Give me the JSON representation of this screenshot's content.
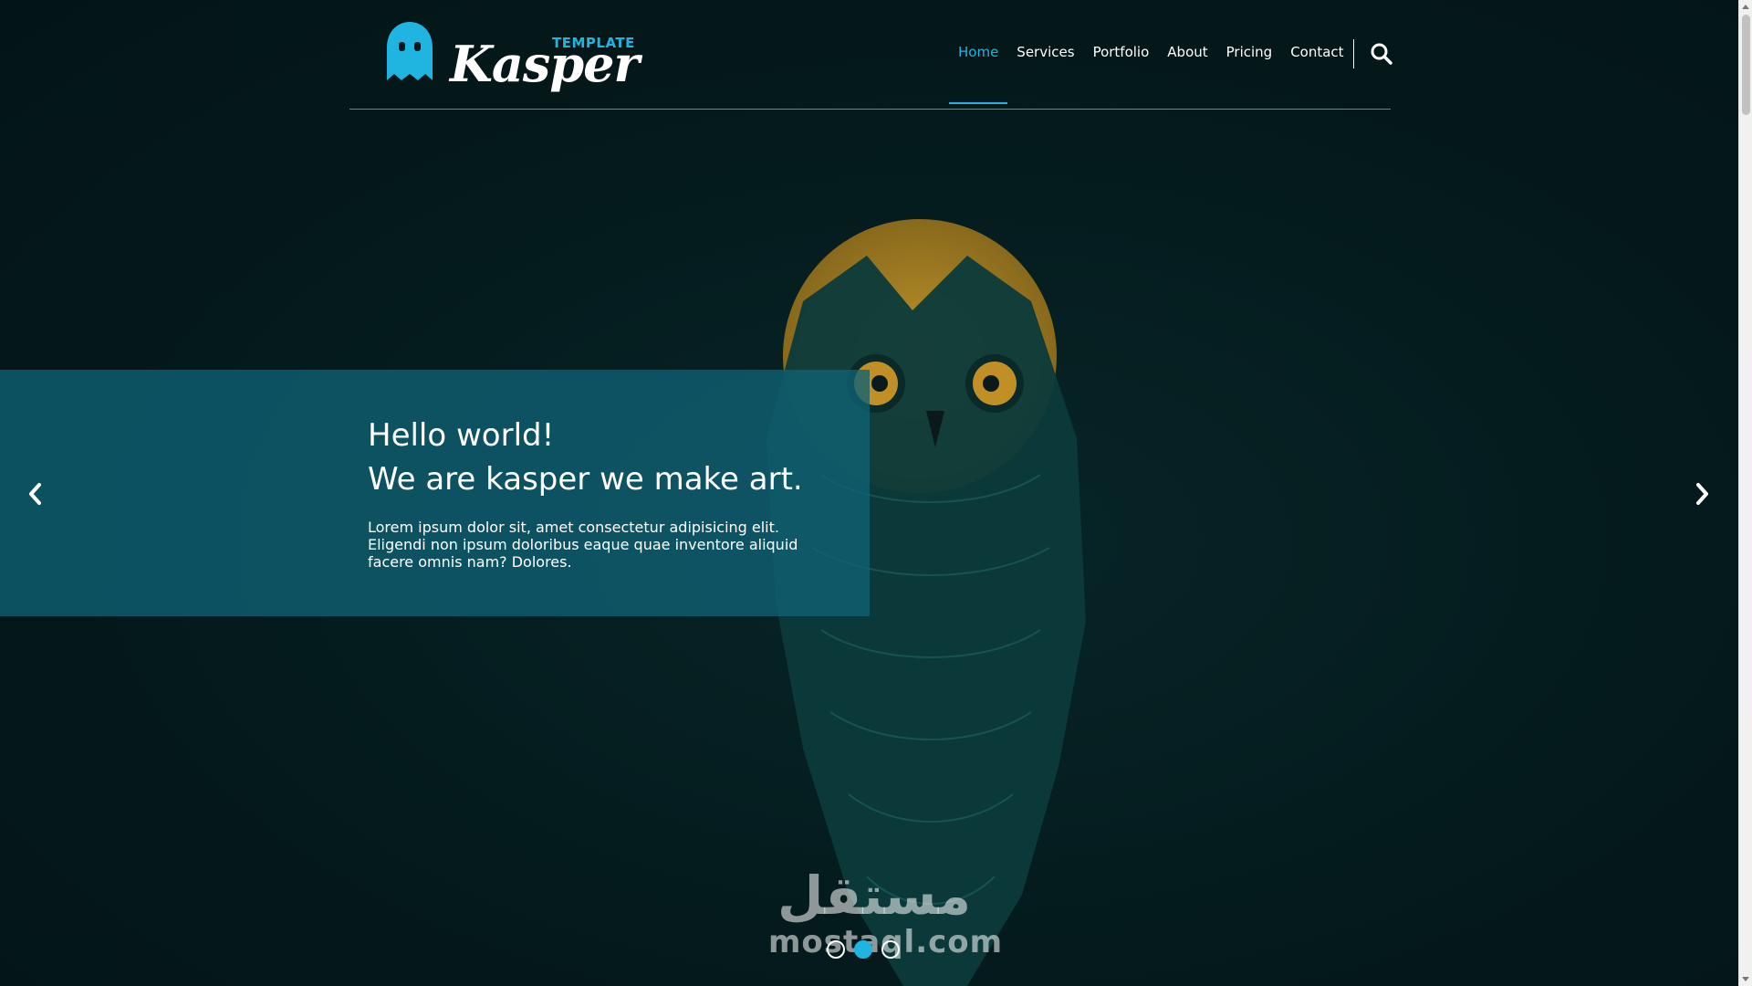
{
  "header": {
    "logo": {
      "template_text": "TEMPLATE",
      "name_text": "Kasper",
      "icon": "ghost-icon"
    },
    "nav": [
      {
        "label": "Home",
        "active": true
      },
      {
        "label": "Services",
        "active": false
      },
      {
        "label": "Portfolio",
        "active": false
      },
      {
        "label": "About",
        "active": false
      },
      {
        "label": "Pricing",
        "active": false
      },
      {
        "label": "Contact",
        "active": false
      }
    ],
    "search_icon": "search-icon"
  },
  "slider": {
    "heading_line1": "Hello world!",
    "heading_line2": "We are kasper we make art.",
    "body": "Lorem ipsum dolor sit, amet consectetur adipisicing elit. Eligendi non ipsum doloribus eaque quae inventore aliquid facere omnis nam? Dolores.",
    "prev_icon": "chevron-left-icon",
    "next_icon": "chevron-right-icon",
    "dots": [
      {
        "active": false
      },
      {
        "active": true
      },
      {
        "active": false
      }
    ]
  },
  "watermark": {
    "arabic": "مستقل",
    "latin": "mostaql.com"
  },
  "colors": {
    "accent": "#1fb5e0",
    "background": "#04191b",
    "slide_box": "#106175"
  }
}
